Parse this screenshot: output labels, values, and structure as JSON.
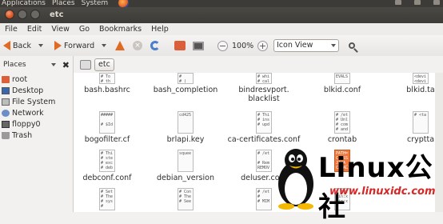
{
  "top_panel": {
    "menus": [
      "Applications",
      "Places",
      "System"
    ]
  },
  "window": {
    "title": "etc"
  },
  "menubar": [
    "File",
    "Edit",
    "View",
    "Go",
    "Bookmarks",
    "Help"
  ],
  "toolbar": {
    "back_label": "Back",
    "forward_label": "Forward",
    "zoom_level": "100%",
    "view_mode": "Icon View"
  },
  "sidebar": {
    "title": "Places",
    "items": [
      {
        "label": "root",
        "icon": "home-folder-icon"
      },
      {
        "label": "Desktop",
        "icon": "desktop-icon"
      },
      {
        "label": "File System",
        "icon": "drive-icon"
      },
      {
        "label": "Network",
        "icon": "network-icon"
      },
      {
        "label": "floppy0",
        "icon": "floppy-icon"
      },
      {
        "label": "Trash",
        "icon": "trash-icon"
      }
    ]
  },
  "pathbar": {
    "current": "etc"
  },
  "files": [
    {
      "name": "bash.bashrc",
      "preview": "# To\n# th"
    },
    {
      "name": "bash_completion",
      "preview": "#\n# ("
    },
    {
      "name": "bindresvport.\nblacklist",
      "preview": "# whi\n# cal"
    },
    {
      "name": "blkid.conf",
      "preview": "EVALS"
    },
    {
      "name": "blkid.ta",
      "preview": "<devi\n<devi"
    },
    {
      "name": "bogofilter.cf",
      "preview": "#####\n\n# $Id"
    },
    {
      "name": "brlapi.key",
      "preview": "cd425"
    },
    {
      "name": "ca-certificates.conf",
      "preview": "# Thi\n# ins\n# upd"
    },
    {
      "name": "crontab",
      "preview": "# /et\n# Unl\n# com\n# and"
    },
    {
      "name": "cryptta",
      "preview": "# <ta"
    },
    {
      "name": "debconf.conf",
      "preview": "# Thi\n# ste\n# exc\n# deb"
    },
    {
      "name": "debian_version",
      "preview": "squee"
    },
    {
      "name": "deluser.conf",
      "preview": "# /et\n\n# Rem\nREMOV"
    },
    {
      "name": "",
      "preview": "PATH=\nCLASS\nJAVA_\nCATAL"
    },
    {
      "name": "",
      "preview": ""
    },
    {
      "name": "",
      "preview": "# Set\n# The\n# sys\n#"
    },
    {
      "name": "",
      "preview": "# Con\n# The\n# See"
    },
    {
      "name": "",
      "preview": "# /et\n#\n# MIM"
    },
    {
      "name": "",
      "preview": "# /et\nbin:x\nbin:x"
    },
    {
      "name": "",
      "preview": ""
    }
  ],
  "watermark": {
    "brand": "Linux公社",
    "url": "www.linuxidc.com"
  },
  "colors": {
    "accent": "#e06a24",
    "panel": "#3c3b37",
    "selection": "#f0783c"
  }
}
